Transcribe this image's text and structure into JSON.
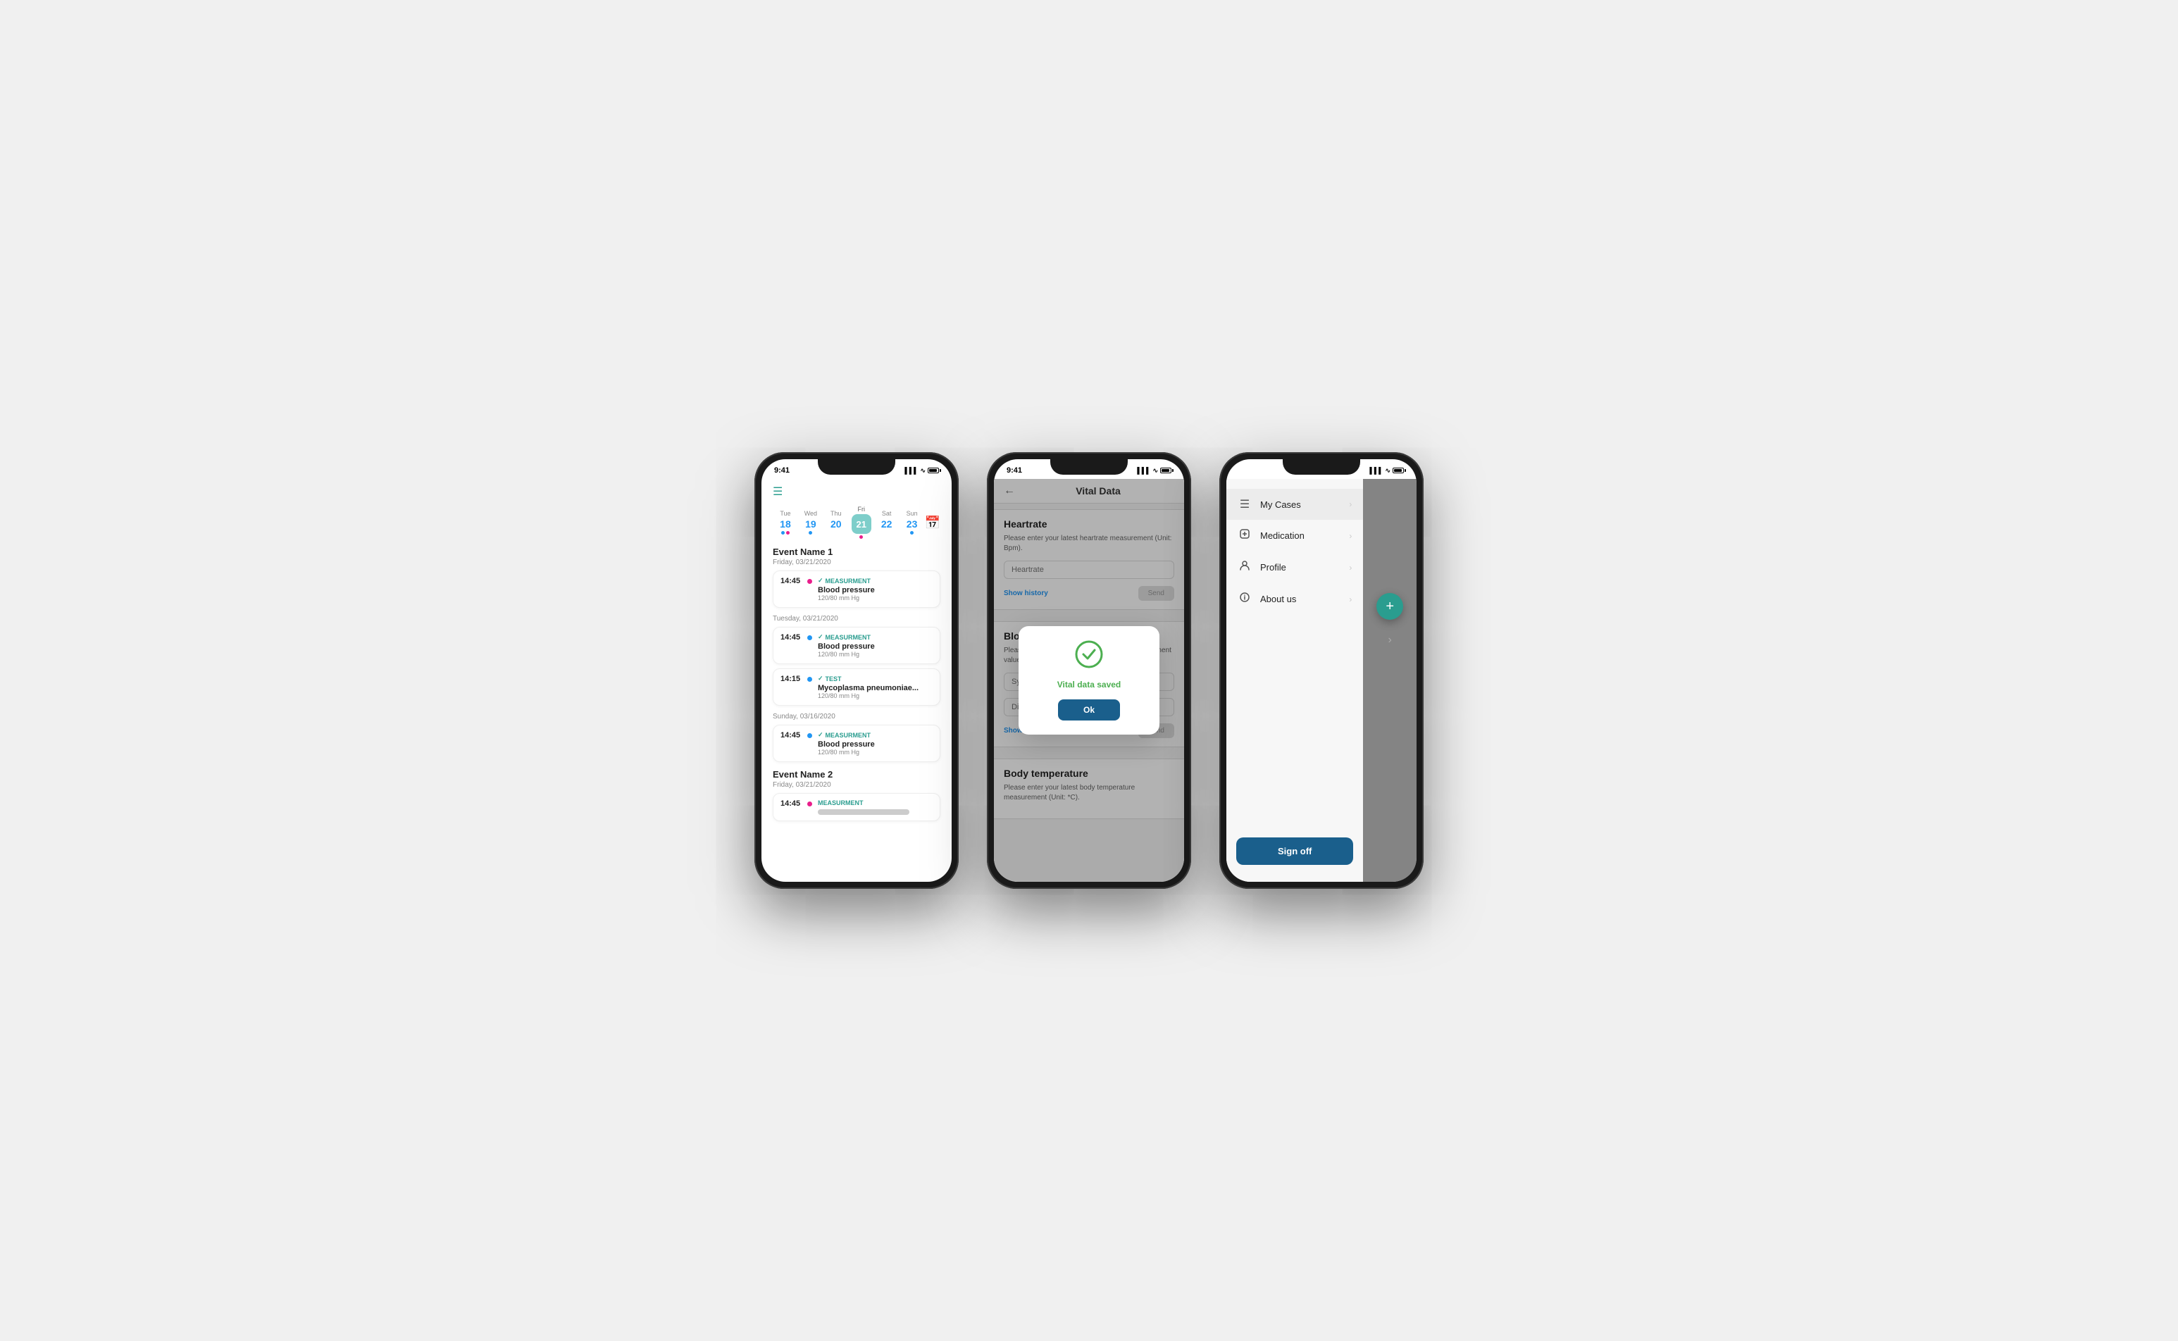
{
  "phone1": {
    "status": {
      "time": "9:41",
      "signal": "▌▌▌",
      "wifi": "WiFi",
      "battery": "100"
    },
    "calendar": {
      "days": [
        {
          "name": "Tue",
          "num": "18",
          "dots": [
            "blue",
            "pink"
          ],
          "selected": false
        },
        {
          "name": "Wed",
          "num": "19",
          "dots": [
            "blue"
          ],
          "selected": false
        },
        {
          "name": "Thu",
          "num": "20",
          "dots": [],
          "selected": false
        },
        {
          "name": "Fri",
          "num": "21",
          "dots": [
            "pink"
          ],
          "selected": true
        },
        {
          "name": "Sat",
          "num": "22",
          "dots": [],
          "selected": false
        },
        {
          "name": "Sun",
          "num": "23",
          "dots": [
            "blue"
          ],
          "selected": false
        }
      ]
    },
    "eventGroups": [
      {
        "name": "Event Name 1",
        "date": "Friday, 03/21/2020",
        "events": [
          {
            "time": "14:45",
            "dotColor": "#e91e8c",
            "tag": "MEASURMENT",
            "tagType": "measurement",
            "title": "Blood pressure",
            "sub": "120/80 mm Hg",
            "checked": true
          }
        ]
      },
      {
        "name": "",
        "date": "Tuesday, 03/21/2020",
        "events": [
          {
            "time": "14:45",
            "dotColor": "#2196f3",
            "tag": "MEASURMENT",
            "tagType": "measurement",
            "title": "Blood pressure",
            "sub": "120/80 mm Hg",
            "checked": true
          },
          {
            "time": "14:15",
            "dotColor": "#2196f3",
            "tag": "TEST",
            "tagType": "test",
            "title": "Mycoplasma pneumoniae...",
            "sub": "120/80 mm Hg",
            "checked": true
          }
        ]
      },
      {
        "name": "",
        "date": "Sunday, 03/16/2020",
        "events": [
          {
            "time": "14:45",
            "dotColor": "#2196f3",
            "tag": "MEASURMENT",
            "tagType": "measurement",
            "title": "Blood pressure",
            "sub": "120/80 mm Hg",
            "checked": true
          }
        ]
      },
      {
        "name": "Event Name 2",
        "date": "Friday, 03/21/2020",
        "events": [
          {
            "time": "14:45",
            "dotColor": "#e91e8c",
            "tag": "MEASURMENT",
            "tagType": "measurement",
            "title": "Blood pressure",
            "sub": "",
            "checked": false
          }
        ]
      }
    ]
  },
  "phone2": {
    "status": {
      "time": "9:41"
    },
    "title": "Vital Data",
    "back_label": "←",
    "sections": [
      {
        "title": "Heartrate",
        "desc": "Please enter your latest heartrate measurement (Unit: Bpm).",
        "placeholder": "Heartrate",
        "show_history": "Show history",
        "send": "Send"
      },
      {
        "title": "Blood pressure",
        "desc": "Please enter your latest blood pressure measurement values.",
        "inputs": [
          {
            "placeholder": "Systolic"
          },
          {
            "placeholder": "Diastolic"
          }
        ],
        "show_history": "Show history",
        "send": "Send"
      },
      {
        "title": "Body temperature",
        "desc": "Please enter your latest body temperature measurement (Unit: *C)."
      }
    ],
    "modal": {
      "icon": "✓",
      "message": "Vital data saved",
      "button": "Ok"
    }
  },
  "phone3": {
    "status": {
      "time": ""
    },
    "menu": {
      "items": [
        {
          "icon": "☰",
          "label": "My Cases",
          "active": true
        },
        {
          "icon": "💊",
          "label": "Medication",
          "active": false
        },
        {
          "icon": "👤",
          "label": "Profile",
          "active": false
        },
        {
          "icon": "ℹ",
          "label": "About us",
          "active": false
        }
      ],
      "sign_off": "Sign off",
      "fab_icon": "+"
    }
  }
}
